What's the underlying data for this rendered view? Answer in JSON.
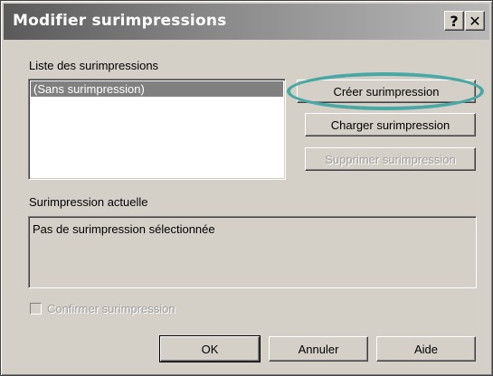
{
  "window": {
    "title": "Modifier surimpressions"
  },
  "titlebar": {
    "help_glyph": "?",
    "close_glyph": "✕"
  },
  "overlay_list": {
    "label": "Liste des surimpressions",
    "items": [
      {
        "label": "(Sans surimpression)",
        "selected": true
      }
    ]
  },
  "buttons": {
    "create": "Créer surimpression",
    "load": "Charger surimpression",
    "delete": "Supprimer surimpression"
  },
  "current_overlay": {
    "label": "Surimpression actuelle",
    "value": "Pas de surimpression sélectionnée"
  },
  "confirm": {
    "label": "Confirmer surimpression",
    "checked": false,
    "enabled": false
  },
  "footer": {
    "ok": "OK",
    "cancel": "Annuler",
    "help": "Aide"
  },
  "colors": {
    "dialog_bg": "#d4d0c8",
    "selection_bg": "#808080",
    "highlight_ring": "#4aa8a4"
  },
  "icons": {
    "help": "help-icon",
    "close": "close-icon"
  }
}
